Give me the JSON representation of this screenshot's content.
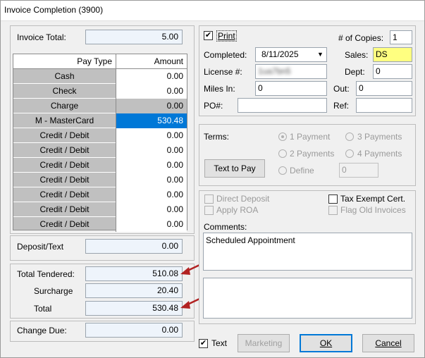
{
  "window": {
    "title": "Invoice Completion (3900)"
  },
  "left": {
    "invoice_total_label": "Invoice Total:",
    "invoice_total_value": "5.00",
    "table": {
      "headers": [
        "Pay Type",
        "Amount"
      ],
      "rows": [
        {
          "type": "Cash",
          "amount": "0.00"
        },
        {
          "type": "Check",
          "amount": "0.00"
        },
        {
          "type": "Charge",
          "amount": "0.00"
        },
        {
          "type": "M - MasterCard",
          "amount": "530.48"
        },
        {
          "type": "Credit / Debit",
          "amount": "0.00"
        },
        {
          "type": "Credit / Debit",
          "amount": "0.00"
        },
        {
          "type": "Credit / Debit",
          "amount": "0.00"
        },
        {
          "type": "Credit / Debit",
          "amount": "0.00"
        },
        {
          "type": "Credit / Debit",
          "amount": "0.00"
        },
        {
          "type": "Credit / Debit",
          "amount": "0.00"
        },
        {
          "type": "Credit / Debit",
          "amount": "0.00"
        }
      ]
    },
    "deposit_label": "Deposit/Text",
    "deposit_value": "0.00",
    "total_tendered_label": "Total Tendered:",
    "total_tendered_value": "510.08",
    "surcharge_label": "Surcharge",
    "surcharge_value": "20.40",
    "total_label": "Total",
    "total_value": "530.48",
    "change_due_label": "Change Due:",
    "change_due_value": "0.00"
  },
  "top_right": {
    "print_label": "Print",
    "print_checked": true,
    "copies_label": "# of Copies:",
    "copies_value": "1",
    "completed_label": "Completed:",
    "completed_value": "8/11/2025",
    "sales_label": "Sales:",
    "sales_value": "DS",
    "license_label": "License #:",
    "license_value": "1ua7bn5",
    "dept_label": "Dept:",
    "dept_value": "0",
    "miles_in_label": "Miles In:",
    "miles_in_value": "0",
    "out_label": "Out:",
    "out_value": "0",
    "po_label": "PO#:",
    "po_value": "",
    "ref_label": "Ref:",
    "ref_value": ""
  },
  "terms": {
    "label": "Terms:",
    "text_to_pay": "Text to Pay",
    "options": [
      "1 Payment",
      "3 Payments",
      "2 Payments",
      "4 Payments",
      "Define"
    ],
    "define_value": "0"
  },
  "options": {
    "direct_deposit": "Direct Deposit",
    "apply_roa": "Apply ROA",
    "tax_exempt": "Tax Exempt Cert.",
    "flag_old": "Flag Old Invoices",
    "comments_label": "Comments:",
    "comments_value": "Scheduled Appointment"
  },
  "footer": {
    "text_label": "Text",
    "text_checked": true,
    "marketing": "Marketing",
    "ok": "OK",
    "cancel": "Cancel"
  },
  "colors": {
    "selection": "#0078d7",
    "annotation_arrow": "#b22222",
    "sales_highlight": "#ffff80"
  }
}
